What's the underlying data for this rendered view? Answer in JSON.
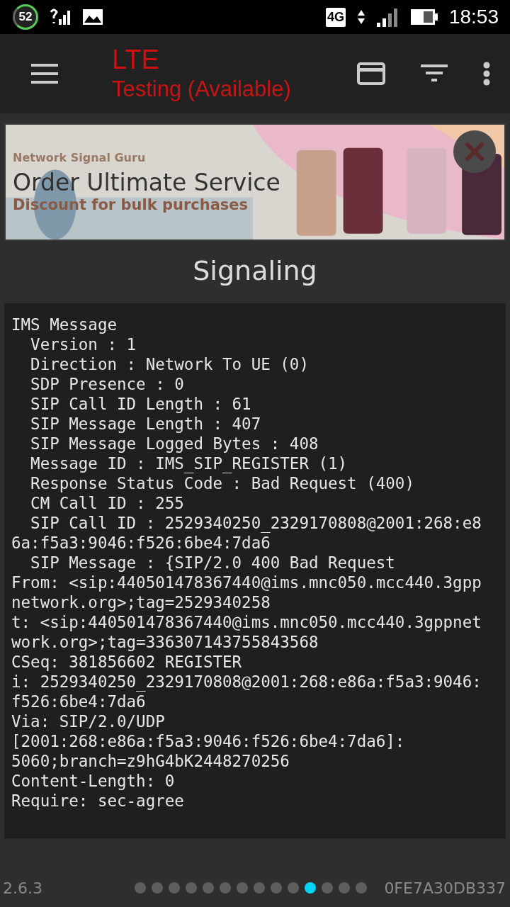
{
  "status_bar": {
    "badge": "52",
    "network": "4G",
    "time": "18:53"
  },
  "app_bar": {
    "title": "LTE",
    "subtitle": "Testing (Available)"
  },
  "banner": {
    "brand": "Network Signal Guru",
    "headline": "Order Ultimate Service",
    "tagline": "Discount for bulk purchases"
  },
  "section_title": "Signaling",
  "message_lines": [
    "IMS Message",
    "  Version : 1",
    "  Direction : Network To UE (0)",
    "  SDP Presence : 0",
    "  SIP Call ID Length : 61",
    "  SIP Message Length : 407",
    "  SIP Message Logged Bytes : 408",
    "  Message ID : IMS_SIP_REGISTER (1)",
    "  Response Status Code : Bad Request (400)",
    "  CM Call ID : 255",
    "  SIP Call ID : 2529340250_2329170808@2001:268:e8",
    "6a:f5a3:9046:f526:6be4:7da6",
    "  SIP Message : {SIP/2.0 400 Bad Request",
    "From: <sip:440501478367440@ims.mnc050.mcc440.3gpp",
    "network.org>;tag=2529340258",
    "t: <sip:440501478367440@ims.mnc050.mcc440.3gppnet",
    "work.org>;tag=336307143755843568",
    "CSeq: 381856602 REGISTER",
    "i: 2529340250_2329170808@2001:268:e86a:f5a3:9046:",
    "f526:6be4:7da6",
    "Via: SIP/2.0/UDP",
    "[2001:268:e86a:f5a3:9046:f526:6be4:7da6]:",
    "5060;branch=z9hG4bK2448270256",
    "Content-Length: 0",
    "Require: sec-agree"
  ],
  "footer": {
    "version": "2.6.3",
    "device_id": "0FE7A30DB337",
    "pages": [
      {
        "selected": false
      },
      {
        "selected": false
      },
      {
        "selected": false
      },
      {
        "selected": false
      },
      {
        "selected": false
      },
      {
        "selected": false
      },
      {
        "selected": false
      },
      {
        "selected": false
      },
      {
        "selected": false
      },
      {
        "selected": false
      },
      {
        "selected": true
      },
      {
        "selected": false
      },
      {
        "selected": false
      },
      {
        "selected": false
      }
    ]
  }
}
